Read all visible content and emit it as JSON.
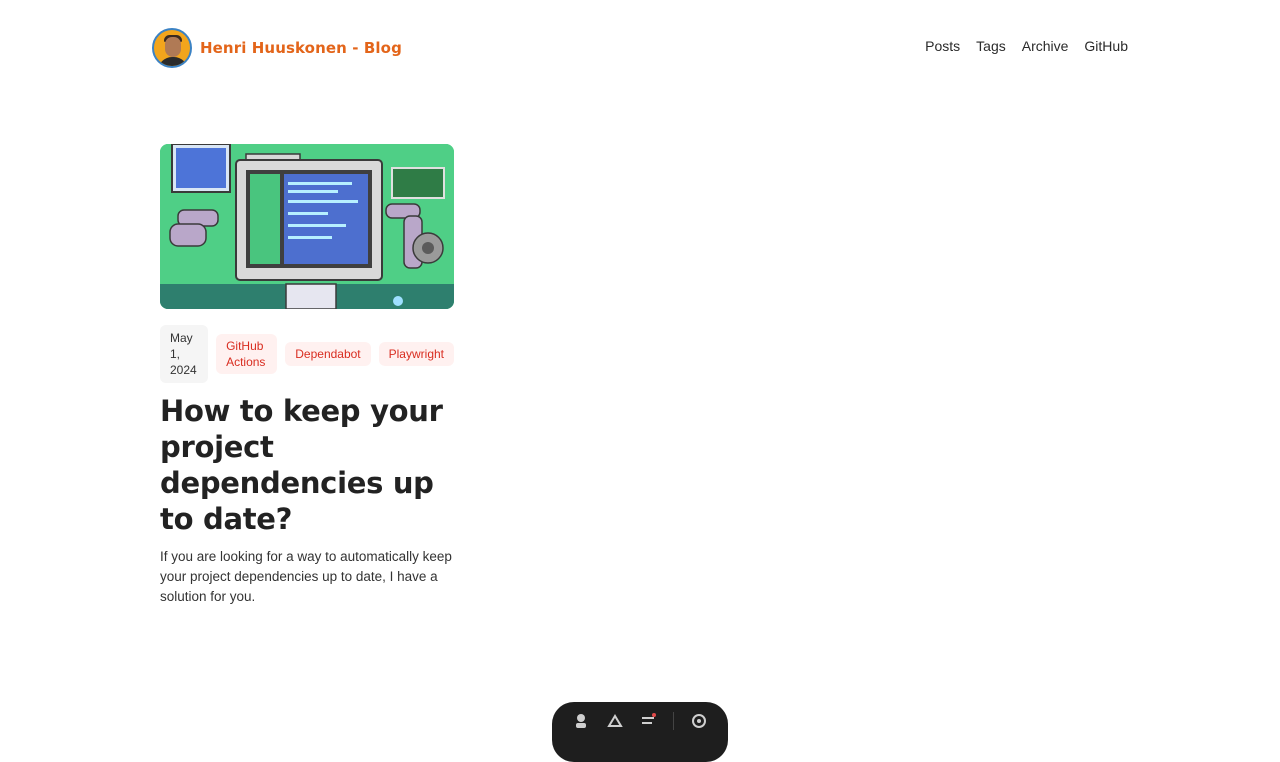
{
  "header": {
    "brand": "Henri Huuskonen - Blog",
    "nav": [
      "Posts",
      "Tags",
      "Archive",
      "GitHub"
    ]
  },
  "post": {
    "date": "May 1, 2024",
    "tags": [
      "GitHub Actions",
      "Dependabot",
      "Playwright"
    ],
    "title": "How to keep your project dependencies up to date?",
    "excerpt": "If you are looking for a way to automatically keep your project dependencies up to date, I have a solution for you."
  },
  "colors": {
    "brand": "#e3651a",
    "tag_text": "#d92d20",
    "tag_bg": "#fff1f0",
    "hero_bg": "#4fcf86"
  },
  "icons": [
    "avatar",
    "toolbar-icons"
  ]
}
